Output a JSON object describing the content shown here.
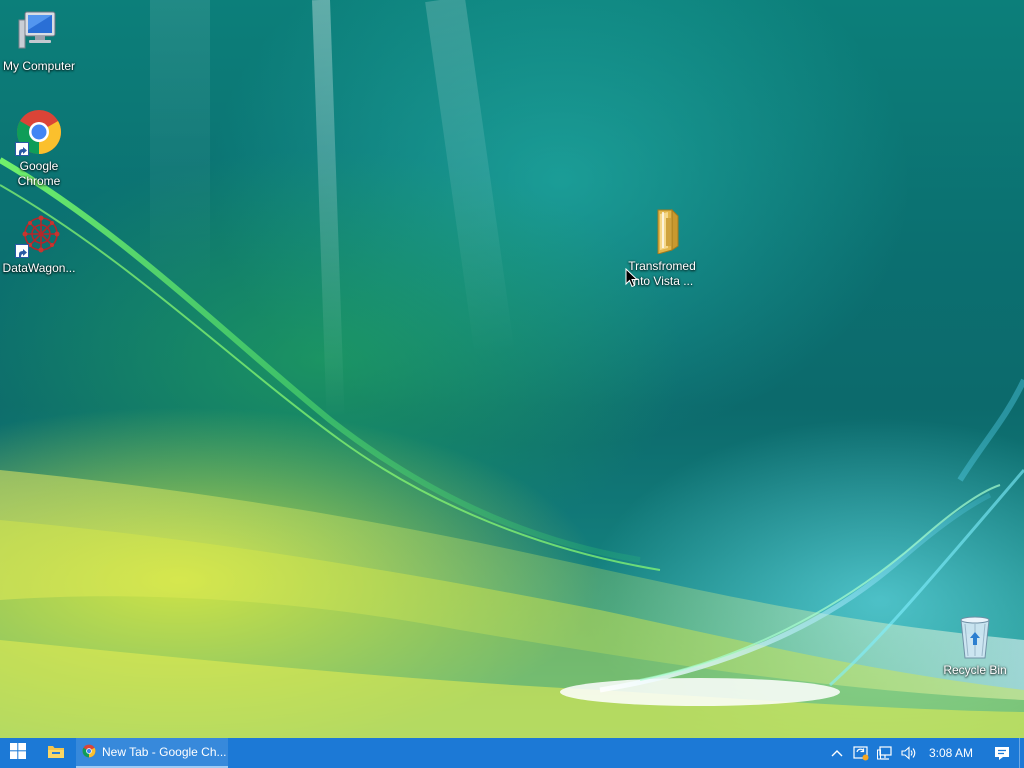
{
  "desktop": {
    "icons": {
      "my_computer": {
        "label": "My Computer",
        "icon": "computer-icon"
      },
      "chrome": {
        "label": "Google Chrome",
        "icon": "chrome-icon"
      },
      "datawagon": {
        "label": "DataWagon...",
        "icon": "datawagon-icon"
      },
      "folder": {
        "label_line1": "Transfromed",
        "label_line2": "into Vista ...",
        "icon": "folder-icon"
      },
      "recycle_bin": {
        "label": "Recycle Bin",
        "icon": "recycle-bin-icon"
      }
    }
  },
  "taskbar": {
    "start_icon": "windows-logo-icon",
    "explorer_icon": "file-explorer-icon",
    "task_items": [
      {
        "label": "New Tab - Google Ch...",
        "icon": "chrome-icon"
      }
    ],
    "tray": {
      "icons": [
        "chevron-up-icon",
        "update-icon",
        "network-icon",
        "volume-icon"
      ],
      "time": "3:08 AM",
      "notification_icon": "action-center-icon"
    }
  },
  "colors": {
    "taskbar": "#1c79d6",
    "wallpaper_base": "#0b6f70",
    "label_text": "#ffffff"
  }
}
